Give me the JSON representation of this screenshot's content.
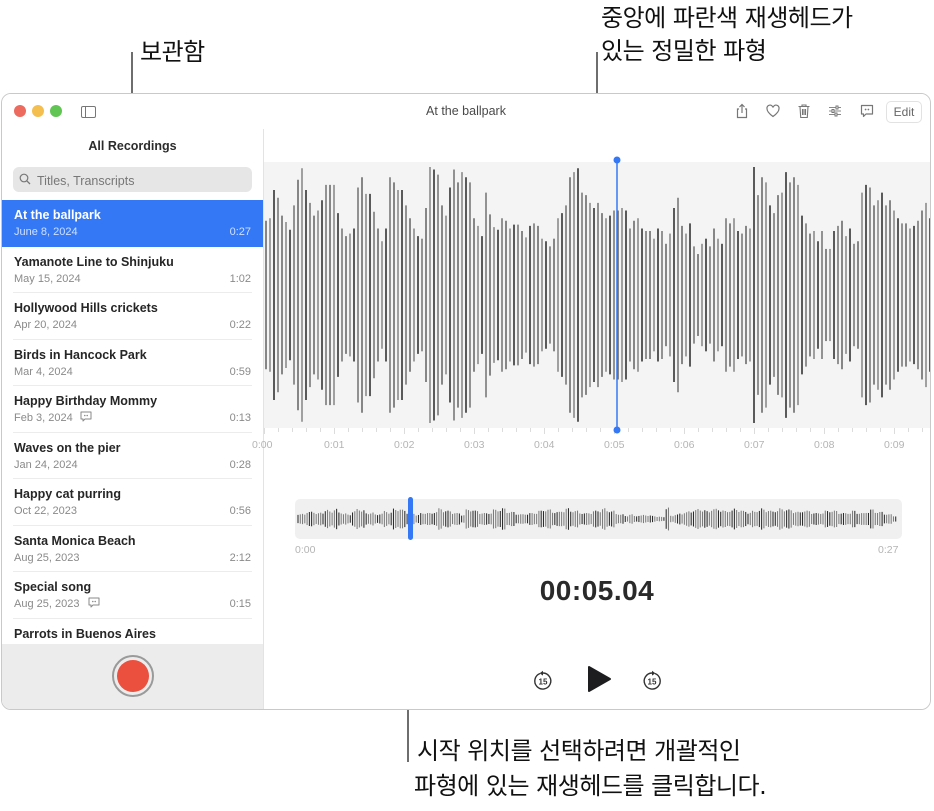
{
  "annotations": {
    "library": "보관함",
    "detailed_waveform": [
      "중앙에 파란색 재생헤드가",
      "있는 정밀한 파형"
    ],
    "overview_waveform": [
      "시작 위치를 선택하려면 개괄적인",
      "파형에 있는 재생헤드를 클릭합니다."
    ]
  },
  "window": {
    "title": "At the ballpark",
    "toolbar": {
      "icons": [
        "share-icon",
        "heart-icon",
        "trash-icon",
        "sliders-icon",
        "transcript-icon"
      ],
      "edit_label": "Edit"
    }
  },
  "sidebar": {
    "heading": "All Recordings",
    "search_placeholder": "Titles, Transcripts",
    "recordings": [
      {
        "title": "At the ballpark",
        "date": "June 8, 2024",
        "duration": "0:27",
        "transcript": false,
        "selected": true
      },
      {
        "title": "Yamanote Line to Shinjuku",
        "date": "May 15, 2024",
        "duration": "1:02",
        "transcript": false
      },
      {
        "title": "Hollywood Hills crickets",
        "date": "Apr 20, 2024",
        "duration": "0:22",
        "transcript": false
      },
      {
        "title": "Birds in Hancock Park",
        "date": "Mar 4, 2024",
        "duration": "0:59",
        "transcript": false
      },
      {
        "title": "Happy Birthday Mommy",
        "date": "Feb 3, 2024",
        "duration": "0:13",
        "transcript": true
      },
      {
        "title": "Waves on the pier",
        "date": "Jan 24, 2024",
        "duration": "0:28",
        "transcript": false
      },
      {
        "title": "Happy cat purring",
        "date": "Oct 22, 2023",
        "duration": "0:56",
        "transcript": false
      },
      {
        "title": "Santa Monica Beach",
        "date": "Aug 25, 2023",
        "duration": "2:12",
        "transcript": false
      },
      {
        "title": "Special song",
        "date": "Aug 25, 2023",
        "duration": "0:15",
        "transcript": true
      },
      {
        "title": "Parrots in Buenos Aires",
        "date": "",
        "duration": "",
        "transcript": false
      }
    ],
    "record_button": "record-icon"
  },
  "player": {
    "ruler_labels": [
      "0:00",
      "0:01",
      "0:02",
      "0:03",
      "0:04",
      "0:05",
      "0:06",
      "0:07",
      "0:08",
      "0:09"
    ],
    "playhead_seconds": 5.04,
    "visible_window_seconds": [
      0,
      9.5
    ],
    "overview": {
      "start_label": "0:00",
      "end_label": "0:27",
      "total_seconds": 27
    },
    "timecode": "00:05.04",
    "controls": {
      "skip_back": "15",
      "skip_forward": "15",
      "play": "play-icon"
    },
    "accent_color": "#3478f6",
    "detail_amplitudes": [
      0.58,
      0.6,
      0.82,
      0.76,
      0.62,
      0.57,
      0.51,
      0.7,
      0.9,
      0.99,
      0.82,
      0.72,
      0.62,
      0.66,
      0.74,
      0.86,
      0.86,
      0.86,
      0.64,
      0.52,
      0.46,
      0.48,
      0.52,
      0.84,
      0.92,
      0.79,
      0.79,
      0.65,
      0.52,
      0.42,
      0.52,
      0.92,
      0.88,
      0.82,
      0.82,
      0.7,
      0.6,
      0.52,
      0.46,
      0.44,
      0.68,
      1.0,
      0.98,
      0.94,
      0.7,
      0.62,
      0.84,
      0.98,
      0.88,
      0.96,
      0.92,
      0.88,
      0.6,
      0.54,
      0.46,
      0.8,
      0.63,
      0.53,
      0.51,
      0.6,
      0.58,
      0.52,
      0.55,
      0.55,
      0.5,
      0.45,
      0.54,
      0.56,
      0.54,
      0.44,
      0.42,
      0.38,
      0.44,
      0.6,
      0.64,
      0.7,
      0.92,
      0.96,
      0.99,
      0.8,
      0.78,
      0.72,
      0.68,
      0.72,
      0.64,
      0.6,
      0.62,
      0.66,
      0.66,
      0.68,
      0.66,
      0.52,
      0.58,
      0.6,
      0.52,
      0.5,
      0.5,
      0.44,
      0.52,
      0.5,
      0.4,
      0.48,
      0.68,
      0.76,
      0.54,
      0.48,
      0.56,
      0.38,
      0.32,
      0.4,
      0.44,
      0.38,
      0.52,
      0.44,
      0.4,
      0.6,
      0.56,
      0.6,
      0.5,
      0.48,
      0.54,
      0.52,
      1.0,
      0.78,
      0.92,
      0.88,
      0.7,
      0.64,
      0.78,
      0.8,
      0.96,
      0.88,
      0.92,
      0.86,
      0.62,
      0.56,
      0.48,
      0.5,
      0.42,
      0.5,
      0.36,
      0.36,
      0.5,
      0.54,
      0.58,
      0.46,
      0.52,
      0.4,
      0.42,
      0.8,
      0.86,
      0.84,
      0.7,
      0.74,
      0.8,
      0.7,
      0.74,
      0.66,
      0.6,
      0.56,
      0.56,
      0.52,
      0.54,
      0.58,
      0.66,
      0.72,
      0.6,
      0.5
    ],
    "overview_amplitudes": [
      0.4,
      0.5,
      0.6,
      0.7,
      0.5,
      0.6,
      0.8,
      0.7,
      0.9,
      0.6,
      0.5,
      0.4,
      0.7,
      0.9,
      0.8,
      0.5,
      0.6,
      0.4,
      0.5,
      0.7,
      0.6,
      0.9,
      0.9,
      0.8,
      0.6,
      0.5,
      0.4,
      0.5,
      0.6,
      0.5,
      0.7,
      0.9,
      0.8,
      0.7,
      0.6,
      0.5,
      0.4,
      0.8,
      0.9,
      0.7,
      0.6,
      0.5,
      0.6,
      0.8,
      0.9,
      0.9,
      0.7,
      0.6,
      0.5,
      0.4,
      0.5,
      0.5,
      0.6,
      0.7,
      0.9,
      0.8,
      0.7,
      0.6,
      0.8,
      0.9,
      0.8,
      0.7,
      0.6,
      0.5,
      0.6,
      0.7,
      0.8,
      0.9,
      0.8,
      0.7,
      0.5,
      0.4,
      0.3,
      0.4,
      0.3,
      0.3,
      0.4,
      0.3,
      0.3,
      0.2,
      0.2,
      1.0,
      0.3,
      0.4,
      0.5,
      0.6,
      0.7,
      0.8,
      0.9,
      0.8,
      0.7,
      0.9,
      0.9,
      0.8,
      0.7,
      0.8,
      0.9,
      0.8,
      0.7,
      0.6,
      0.7,
      0.8,
      0.9,
      0.8,
      0.7,
      0.8,
      0.9,
      0.9,
      0.8,
      0.7,
      0.6,
      0.8,
      0.7,
      0.6,
      0.5,
      0.6,
      0.7,
      0.8,
      0.7,
      0.6,
      0.5,
      0.6,
      0.7,
      0.6,
      0.5,
      0.7,
      0.8,
      0.7,
      0.6,
      0.5,
      0.4,
      0.3
    ]
  }
}
